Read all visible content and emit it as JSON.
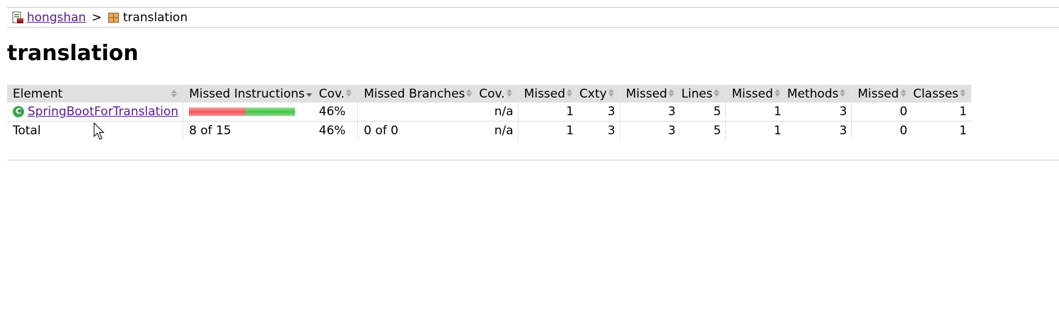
{
  "breadcrumb": {
    "root_label": "hongshan",
    "separator": ">",
    "current_label": "translation"
  },
  "page_title": "translation",
  "table": {
    "headers": {
      "element": "Element",
      "missed_instructions": "Missed Instructions",
      "instr_cov": "Cov.",
      "missed_branches": "Missed Branches",
      "branch_cov": "Cov.",
      "cxty_missed": "Missed",
      "cxty": "Cxty",
      "lines_missed": "Missed",
      "lines": "Lines",
      "methods_missed": "Missed",
      "methods": "Methods",
      "classes_missed": "Missed",
      "classes": "Classes"
    },
    "rows": [
      {
        "element": "SpringBootForTranslation",
        "instr_bar": {
          "missed": 8,
          "covered": 7
        },
        "instr_cov": "46%",
        "branch_cov": "n/a",
        "cxty_missed": "1",
        "cxty": "3",
        "lines_missed": "3",
        "lines": "5",
        "methods_missed": "1",
        "methods": "3",
        "classes_missed": "0",
        "classes": "1"
      }
    ],
    "total": {
      "label": "Total",
      "missed_instructions": "8 of 15",
      "instr_cov": "46%",
      "missed_branches": "0 of 0",
      "branch_cov": "n/a",
      "cxty_missed": "1",
      "cxty": "3",
      "lines_missed": "3",
      "lines": "5",
      "methods_missed": "1",
      "methods": "3",
      "classes_missed": "0",
      "classes": "1"
    }
  },
  "colors": {
    "link": "#551a8b",
    "header_bg": "#e0e0e0",
    "bar_missed": "#f05a5a",
    "bar_covered": "#44c544"
  },
  "icons": {
    "root": "report-icon",
    "package": "package-icon",
    "class": "class-icon",
    "sort": "sort-arrows-icon"
  }
}
